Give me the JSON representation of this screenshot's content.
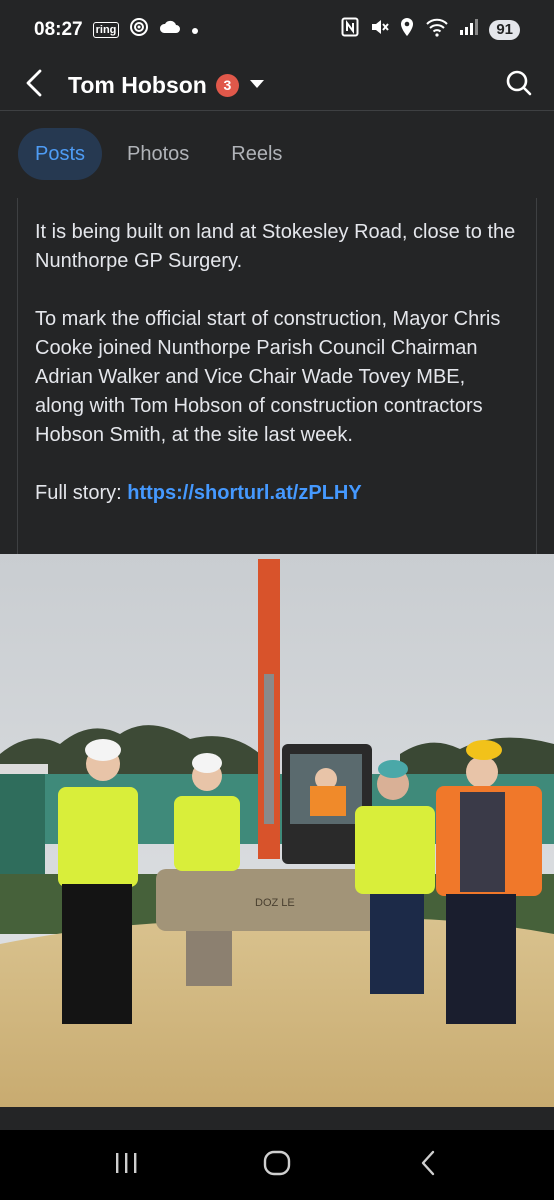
{
  "status_bar": {
    "time": "08:27",
    "ring_label": "ring",
    "battery": "91",
    "icons": [
      "ring-icon",
      "hotspot-icon",
      "cloud-icon",
      "dot-icon",
      "nfc-icon",
      "mute-icon",
      "location-icon",
      "wifi-icon",
      "signal-icon"
    ]
  },
  "header": {
    "title": "Tom Hobson",
    "badge_count": "3",
    "icons": [
      "back-arrow-icon",
      "chevron-down-icon",
      "search-icon"
    ]
  },
  "tabs": [
    {
      "label": "Posts",
      "active": true
    },
    {
      "label": "Photos",
      "active": false
    },
    {
      "label": "Reels",
      "active": false
    }
  ],
  "post": {
    "paragraph_1": "It is being built on land at Stokesley Road, close to the Nunthorpe GP Surgery.",
    "paragraph_2": "To mark the official start of construction, Mayor Chris Cooke joined Nunthorpe Parish Council Chairman Adrian Walker and Vice Chair Wade Tovey MBE, along with Tom Hobson of construction contractors Hobson Smith, at the site last week.",
    "full_story_label": "Full story: ",
    "link_text": "https://shorturl.at/zPLHY"
  },
  "photo": {
    "alt": "Five men in hard hats and hi-vis vests standing in front of an orange excavator with a raised bucket on a gravel construction site",
    "bucket_text": "DOZ LE"
  },
  "colors": {
    "background": "#242526",
    "accent": "#4599ff",
    "active_tab_bg": "#263951",
    "badge": "#e0584a"
  },
  "nav_bar": {
    "icons": [
      "recent-apps-icon",
      "home-icon",
      "back-icon"
    ]
  }
}
